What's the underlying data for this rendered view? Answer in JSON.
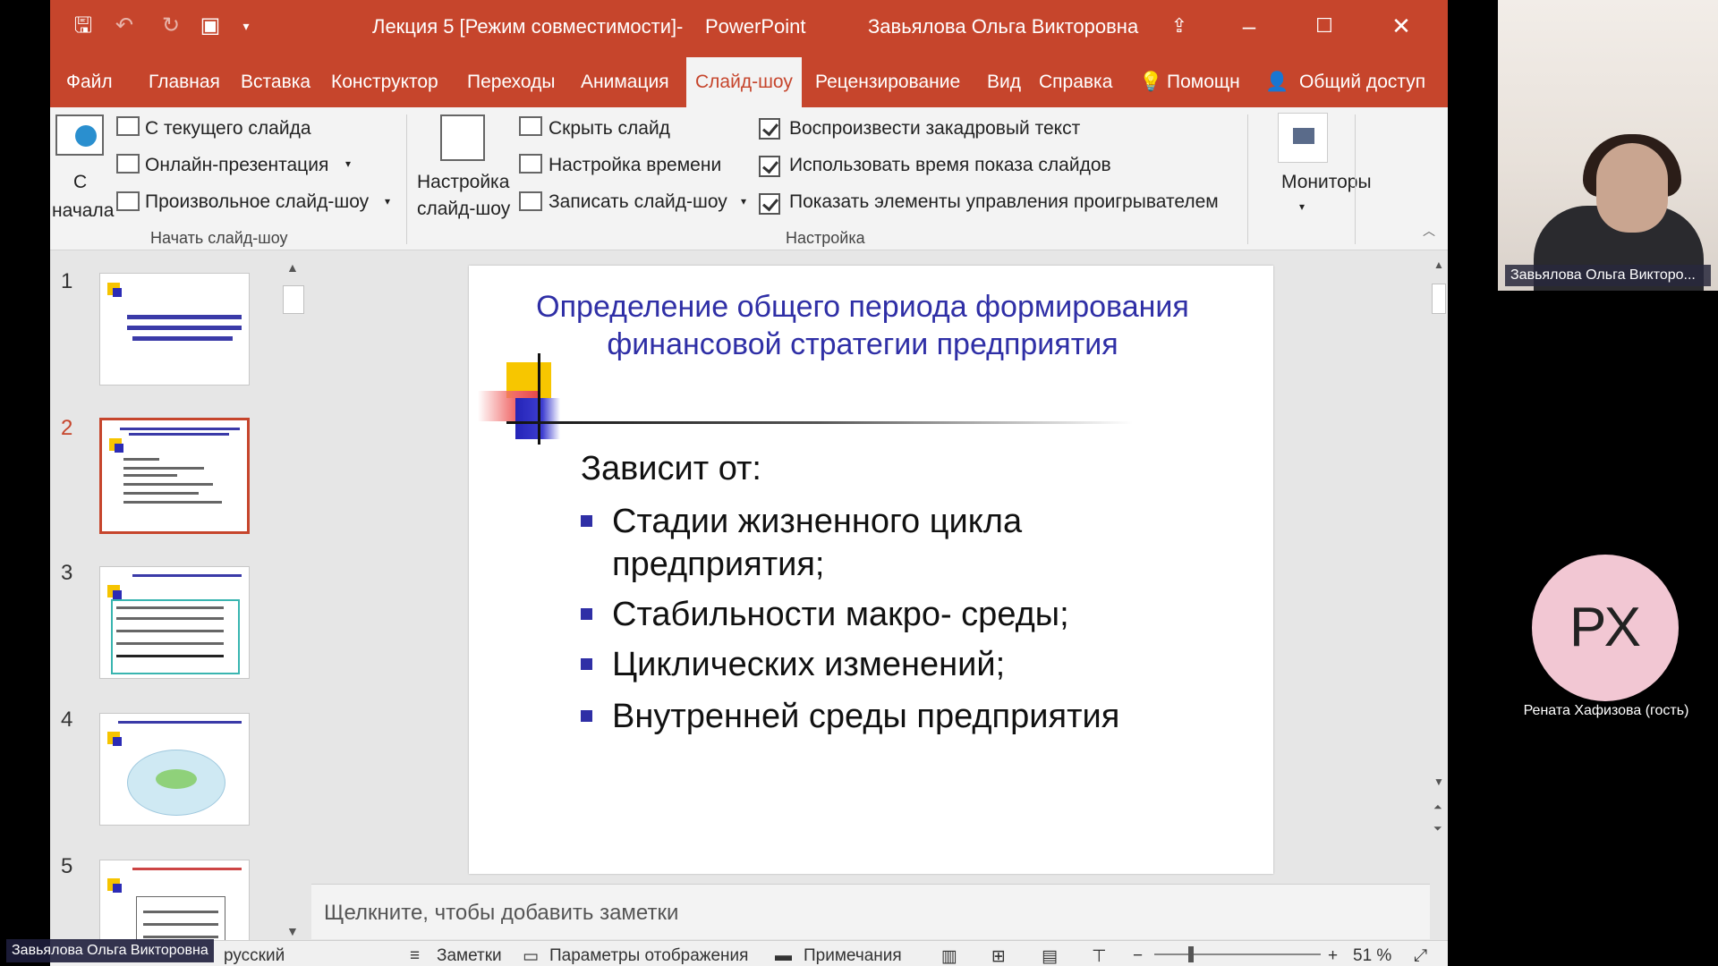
{
  "titlebar": {
    "doc_title": "Лекция 5 [Режим совместимости]",
    "separator": "-",
    "app_name": "PowerPoint",
    "user_name": "Завьялова Ольга Викторовна"
  },
  "menu": {
    "tabs": [
      "Файл",
      "Главная",
      "Вставка",
      "Конструктор",
      "Переходы",
      "Анимация",
      "Слайд-шоу",
      "Рецензирование",
      "Вид",
      "Справка",
      "Помощн",
      "Общий доступ"
    ],
    "active": "Слайд-шоу"
  },
  "ribbon": {
    "start_from_beginning": "С начала",
    "from_current": "С текущего слайда",
    "online_presentation": "Онлайн-презентация",
    "custom_show": "Произвольное слайд-шоу",
    "group_start": "Начать слайд-шоу",
    "setup_show": "Настройка слайд-шоу",
    "hide_slide": "Скрыть слайд",
    "rehearse_timings": "Настройка времени",
    "record_show": "Записать слайд-шоу",
    "play_narrations": "Воспроизвести закадровый текст",
    "use_timings": "Использовать время показа слайдов",
    "show_media_controls": "Показать элементы управления проигрывателем",
    "group_setup": "Настройка",
    "monitors": "Мониторы"
  },
  "thumbnails": [
    {
      "number": "1",
      "selected": false
    },
    {
      "number": "2",
      "selected": true
    },
    {
      "number": "3",
      "selected": false
    },
    {
      "number": "4",
      "selected": false
    },
    {
      "number": "5",
      "selected": false
    }
  ],
  "slide": {
    "title": "Определение общего периода формирования финансовой стратегии предприятия",
    "depends_on": "Зависит от:",
    "bullets": [
      "Стадии жизненного цикла предприятия;",
      "Стабильности макро- среды;",
      "Циклических изменений;",
      "Внутренней среды предприятия"
    ]
  },
  "notes": {
    "placeholder": "Щелкните, чтобы добавить заметки"
  },
  "status": {
    "language": "русский",
    "notes": "Заметки",
    "display_settings": "Параметры отображения",
    "comments": "Примечания",
    "zoom": "51 %"
  },
  "participants": {
    "presenter_label": "Завьялова Ольга Викторо...",
    "guest_initials": "РХ",
    "guest_name": "Рената Хафизова (гость)",
    "self_label": "Завьялова Ольга Викторовна"
  },
  "colors": {
    "accent": "#c6452c",
    "slide_title": "#2f2fa6"
  }
}
